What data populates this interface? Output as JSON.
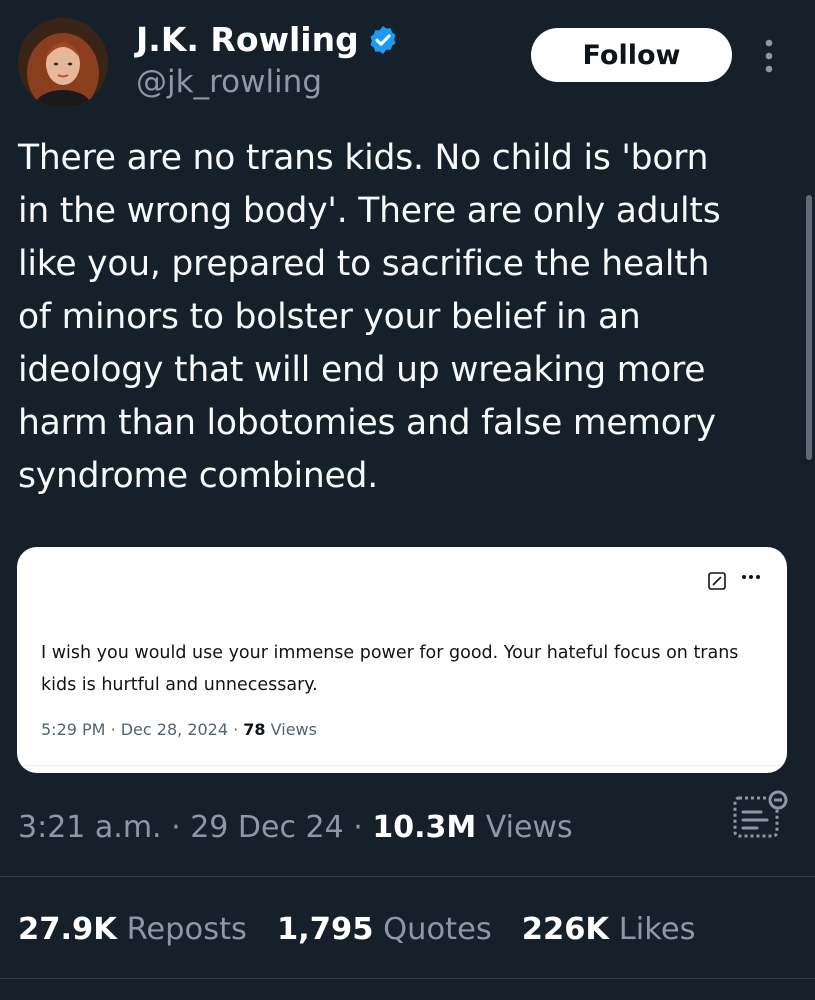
{
  "author": {
    "display_name": "J.K. Rowling",
    "handle": "@jk_rowling",
    "verified": true,
    "verified_color": "#1d9bf0"
  },
  "actions": {
    "follow_label": "Follow",
    "more_icon": "more-vertical-icon"
  },
  "tweet": {
    "text": "There are no trans kids. No child is 'born\nin the wrong body'. There are only adults\nlike you, prepared to sacrifice the health\nof minors to bolster your belief in an\nideology that will end up wreaking more\nharm than lobotomies and false memory\nsyndrome combined.",
    "time": "3:21 a.m.",
    "date": "29 Dec 24",
    "views_count": "10.3M",
    "views_label": "Views"
  },
  "quoted": {
    "text": "I wish you would use your immense power for good. Your hateful focus on trans kids is hurtful and unnecessary.",
    "time": "5:29 PM",
    "date": "Dec 28, 2024",
    "views_count": "78",
    "views_label": "Views"
  },
  "stats": {
    "reposts_count": "27.9K",
    "reposts_label": "Reposts",
    "quotes_count": "1,795",
    "quotes_label": "Quotes",
    "likes_count": "226K",
    "likes_label": "Likes"
  },
  "colors": {
    "background": "#15202b",
    "secondary_text": "#8b98a5",
    "accent": "#1d9bf0"
  }
}
